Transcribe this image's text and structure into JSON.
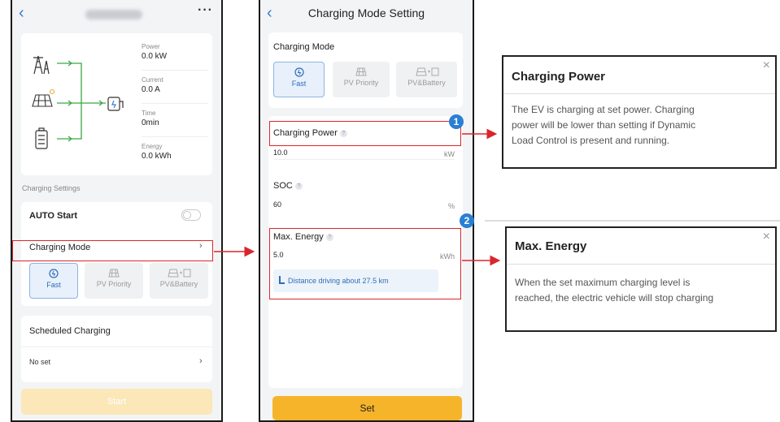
{
  "screen1": {
    "more_label": "···",
    "stats": [
      {
        "label": "Power",
        "value": "0.0 kW"
      },
      {
        "label": "Current",
        "value": "0.0 A"
      },
      {
        "label": "Time",
        "value": "0min"
      },
      {
        "label": "Energy",
        "value": "0.0 kWh"
      }
    ],
    "charging_settings_label": "Charging Settings",
    "auto_start_label": "AUTO Start",
    "auto_start_enabled": false,
    "charging_mode_label": "Charging Mode",
    "modes": [
      "Fast",
      "PV Priority",
      "PV&Battery"
    ],
    "selected_mode": "Fast",
    "scheduled_label": "Scheduled Charging",
    "no_set_label": "No set",
    "start_label": "Start"
  },
  "screen2": {
    "title": "Charging Mode Setting",
    "charging_mode_label": "Charging Mode",
    "modes": [
      "Fast",
      "PV Priority",
      "PV&Battery"
    ],
    "charging_power_label": "Charging Power",
    "charging_power_value": "10.0",
    "charging_power_unit": "kW",
    "soc_label": "SOC",
    "soc_value": "60",
    "soc_unit": "%",
    "max_energy_label": "Max. Energy",
    "max_energy_value": "5.0",
    "max_energy_unit": "kWh",
    "distance_hint": "Distance driving about 27.5 km",
    "set_label": "Set",
    "help_glyph": "?"
  },
  "badges": [
    "1",
    "2"
  ],
  "popups": [
    {
      "title": "Charging Power",
      "body": [
        "The EV is charging at set power. Charging",
        "power will be lower than setting if Dynamic",
        "Load Control is present and running."
      ],
      "close": "×"
    },
    {
      "title": "Max. Energy",
      "body": [
        "When the set maximum charging level is",
        "reached, the electric vehicle will stop charging"
      ],
      "close": "×"
    }
  ],
  "colors": {
    "accent_blue": "#2a7fd4",
    "highlight_red": "#d9262c",
    "flow_green": "#3aa845",
    "set_button": "#f5b42a"
  }
}
